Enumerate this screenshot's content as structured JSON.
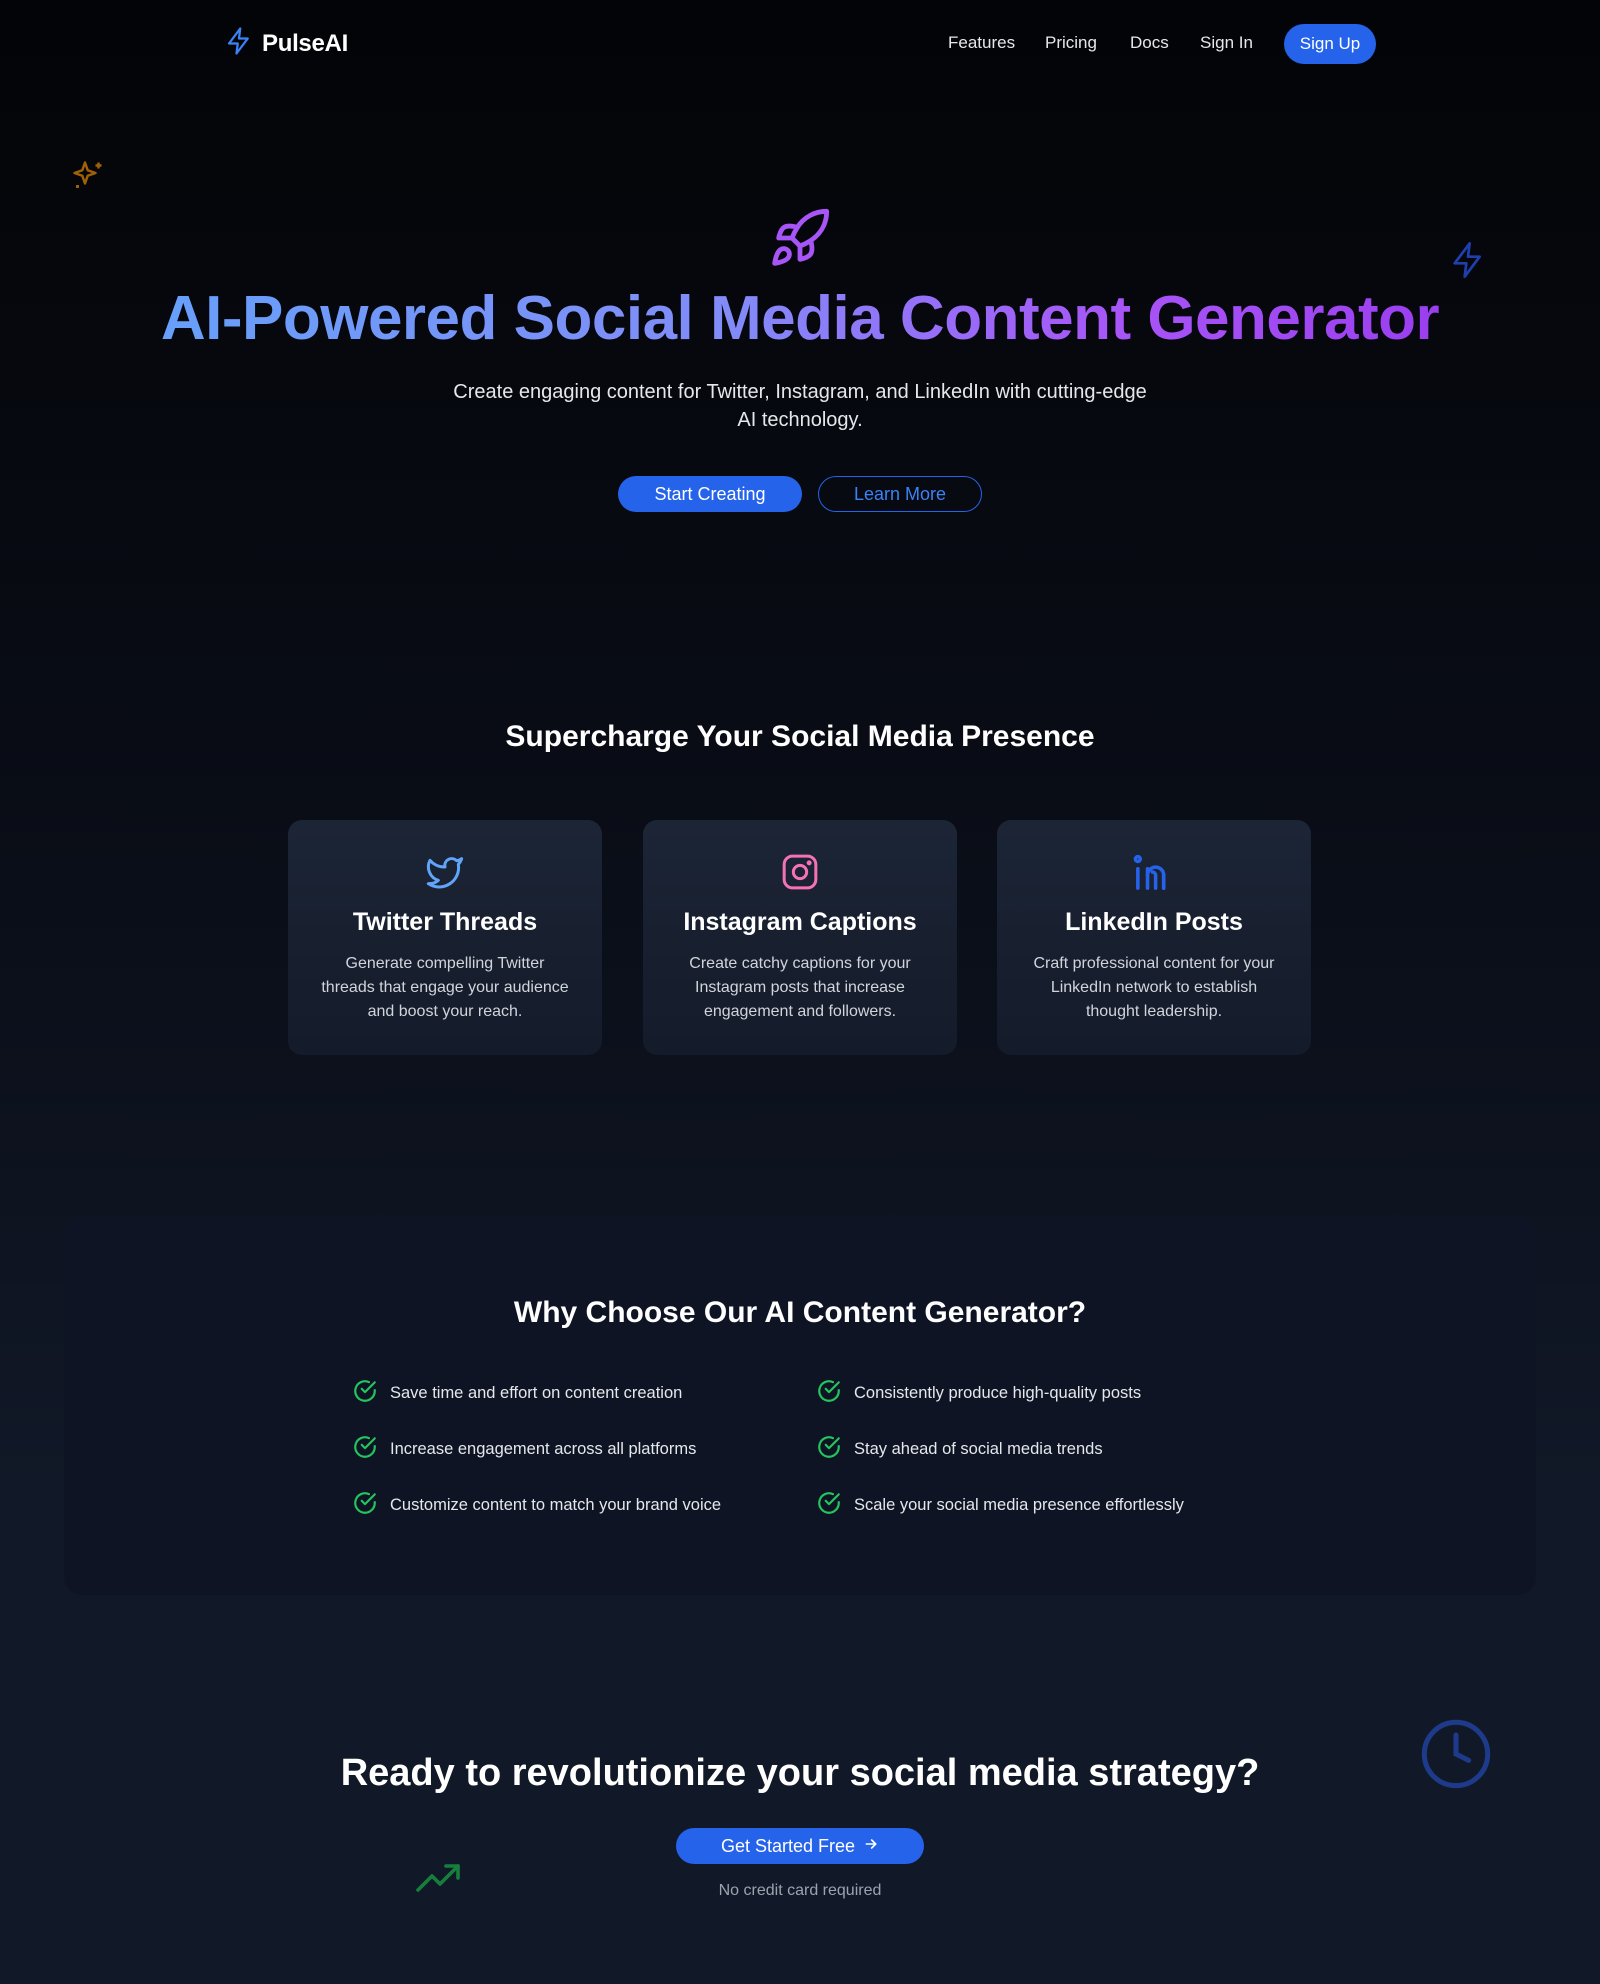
{
  "nav": {
    "brand": "PulseAI",
    "links": [
      "Features",
      "Pricing",
      "Docs",
      "Sign In"
    ],
    "signup_label": "Sign Up"
  },
  "hero": {
    "title": "AI-Powered Social Media Content Generator",
    "subtitle": "Create engaging content for Twitter, Instagram, and LinkedIn with cutting-edge AI technology.",
    "primary_cta": "Start Creating",
    "secondary_cta": "Learn More"
  },
  "features": {
    "title": "Supercharge Your Social Media Presence",
    "cards": [
      {
        "title": "Twitter Threads",
        "description": "Generate compelling Twitter threads that engage your audience and boost your reach.",
        "icon": "twitter-icon"
      },
      {
        "title": "Instagram Captions",
        "description": "Create catchy captions for your Instagram posts that increase engagement and followers.",
        "icon": "instagram-icon"
      },
      {
        "title": "LinkedIn Posts",
        "description": "Craft professional content for your LinkedIn network to establish thought leadership.",
        "icon": "linkedin-icon"
      }
    ]
  },
  "why": {
    "title": "Why Choose Our AI Content Generator?",
    "benefits": [
      "Save time and effort on content creation",
      "Consistently produce high-quality posts",
      "Increase engagement across all platforms",
      "Stay ahead of social media trends",
      "Customize content to match your brand voice",
      "Scale your social media presence effortlessly"
    ]
  },
  "cta": {
    "title": "Ready to revolutionize your social media strategy?",
    "button_label": "Get Started Free",
    "note": "No credit card required"
  },
  "colors": {
    "accent": "#2563eb",
    "check": "#22c55e",
    "twitter": "#60a5fa",
    "instagram": "#f472b6",
    "linkedin": "#2563eb",
    "rocket": "#a855f7"
  }
}
